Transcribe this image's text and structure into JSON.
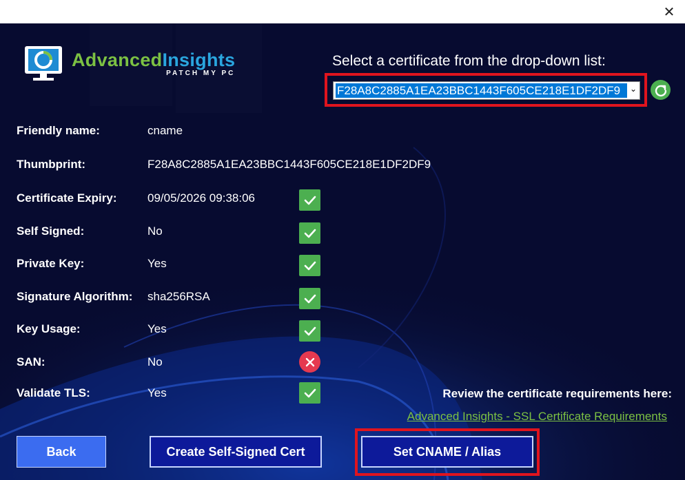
{
  "window": {
    "close_glyph": "✕"
  },
  "logo": {
    "title_part1": "Advanced",
    "title_part2": "Insights",
    "subtitle": "PATCH MY PC"
  },
  "certificate_select": {
    "label": "Select a certificate from the drop-down list:",
    "selected": "F28A8C2885A1EA23BBC1443F605CE218E1DF2DF9",
    "arrow": "⌄"
  },
  "fields": {
    "friendly_name": {
      "label": "Friendly name:",
      "value": "cname"
    },
    "thumbprint": {
      "label": "Thumbprint:",
      "value": "F28A8C2885A1EA23BBC1443F605CE218E1DF2DF9"
    },
    "expiry": {
      "label": "Certificate Expiry:",
      "value": "09/05/2026 09:38:06",
      "status": "ok"
    },
    "self_signed": {
      "label": "Self Signed:",
      "value": "No",
      "status": "ok"
    },
    "private_key": {
      "label": "Private Key:",
      "value": "Yes",
      "status": "ok"
    },
    "signature_algorithm": {
      "label": "Signature Algorithm:",
      "value": "sha256RSA",
      "status": "ok"
    },
    "key_usage": {
      "label": "Key Usage:",
      "value": "Yes",
      "status": "ok"
    },
    "san": {
      "label": "SAN:",
      "value": "No",
      "status": "fail"
    },
    "validate_tls": {
      "label": "Validate TLS:",
      "value": "Yes",
      "status": "ok"
    }
  },
  "review": {
    "text": "Review the certificate requirements here:",
    "link": "Advanced Insights - SSL Certificate Requirements"
  },
  "buttons": {
    "back": "Back",
    "create": "Create Self-Signed Cert",
    "set_cname": "Set CNAME / Alias"
  },
  "colors": {
    "background": "#070b30",
    "ok": "#4caf50",
    "fail": "#e53950",
    "highlight": "#e0141e",
    "link": "#7cc143"
  },
  "icons": {
    "refresh": "refresh-icon",
    "check": "check-icon",
    "cross": "x-icon",
    "close": "close-icon"
  }
}
